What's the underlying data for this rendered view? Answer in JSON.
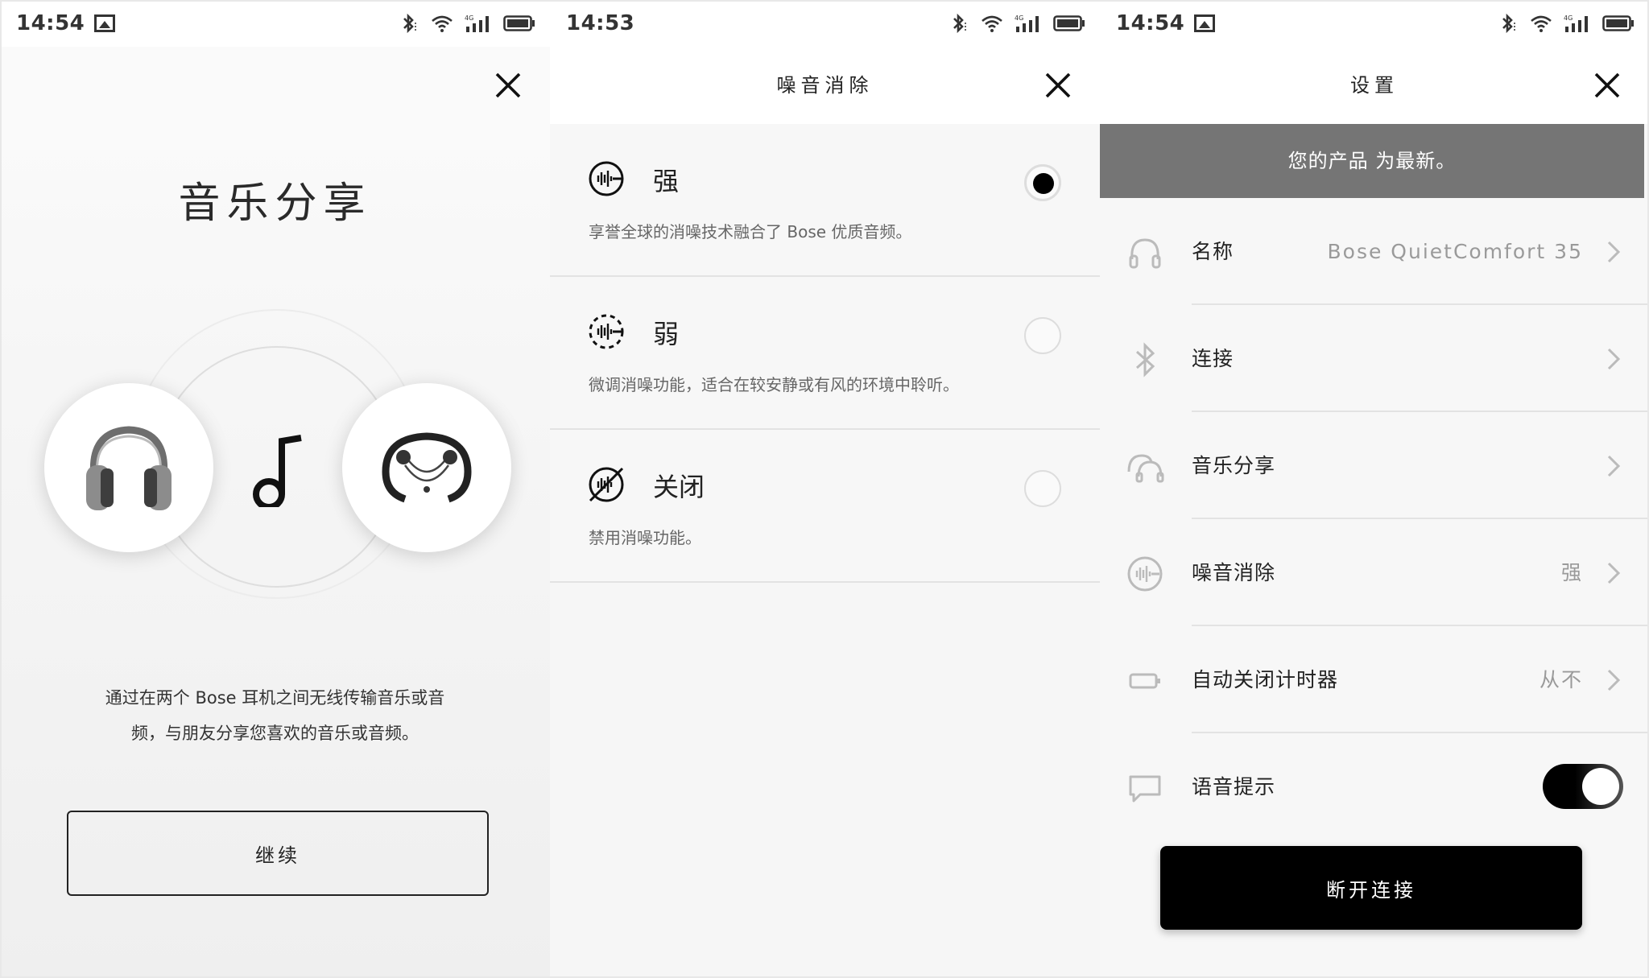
{
  "screens": [
    {
      "id": "music-share",
      "status": {
        "time": "14:54",
        "network": "4G"
      },
      "title": "音乐分享",
      "description_line1": "通过在两个 Bose 耳机之间无线传输音乐或音",
      "description_line2": "频，与朋友分享您喜欢的音乐或音频。",
      "continue_label": "继续"
    },
    {
      "id": "noise-cancelling",
      "status": {
        "time": "14:53",
        "network": "4G"
      },
      "title": "噪音消除",
      "options": [
        {
          "label": "强",
          "description": "享誉全球的消噪技术融合了 Bose 优质音频。",
          "selected": true
        },
        {
          "label": "弱",
          "description": "微调消噪功能，适合在较安静或有风的环境中聆听。",
          "selected": false
        },
        {
          "label": "关闭",
          "description": "禁用消噪功能。",
          "selected": false
        }
      ]
    },
    {
      "id": "settings",
      "status": {
        "time": "14:54",
        "network": "4G"
      },
      "title": "设置",
      "banner": "您的产品 为最新。",
      "rows": [
        {
          "label": "名称",
          "value": "Bose QuietComfort 35",
          "icon": "headphones-icon"
        },
        {
          "label": "连接",
          "value": "",
          "icon": "bluetooth-icon"
        },
        {
          "label": "音乐分享",
          "value": "",
          "icon": "music-share-icon"
        },
        {
          "label": "噪音消除",
          "value": "强",
          "icon": "noise-cancel-icon"
        },
        {
          "label": "自动关闭计时器",
          "value": "从不",
          "icon": "battery-icon"
        },
        {
          "label": "语音提示",
          "value": "",
          "icon": "speech-bubble-icon",
          "toggle_on": true
        }
      ],
      "disconnect_label": "断开连接"
    }
  ],
  "colors": {
    "accent": "#000000",
    "banner_bg": "#757575",
    "muted_text": "#9a9a9a"
  }
}
